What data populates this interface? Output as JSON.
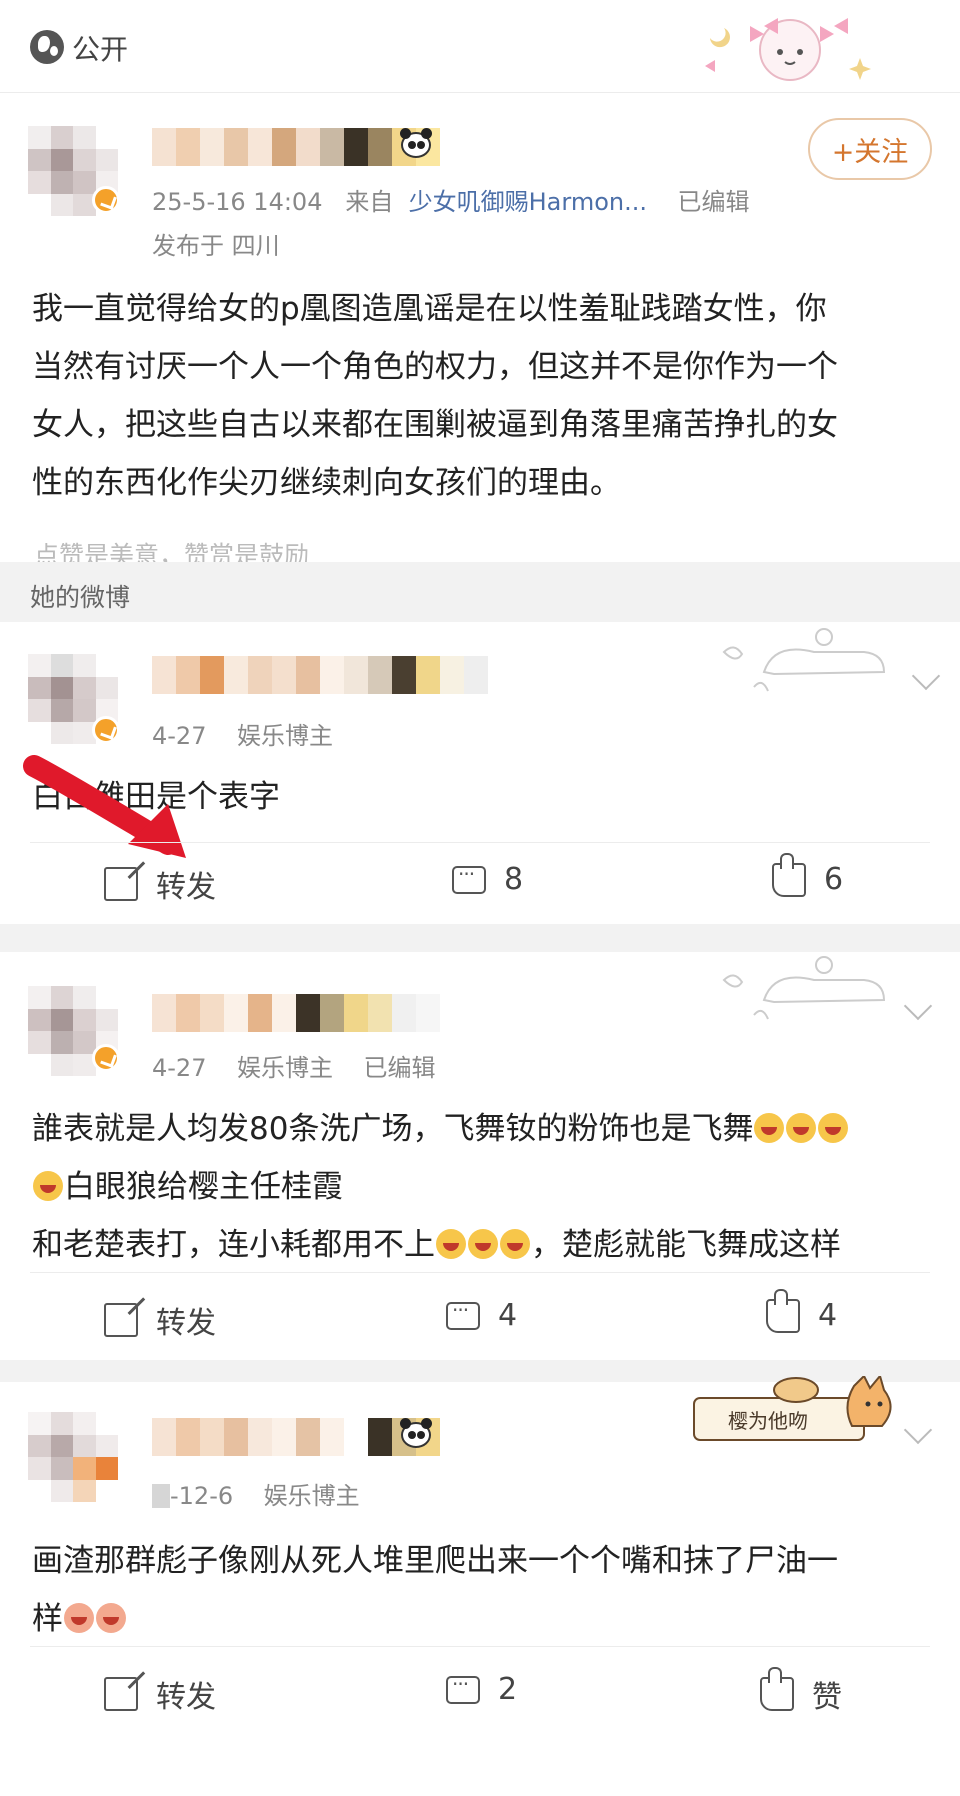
{
  "topbar": {
    "visibility_label": "公开"
  },
  "main_post": {
    "time": "25-5-16 14:04",
    "source_prefix": "来自",
    "source_device": "少女叽御赐Harmon...",
    "edited": "已编辑",
    "location": "发布于 四川",
    "follow_label": "+关注",
    "content": [
      "我一直觉得给女的p凰图造凰谣是在以性羞耻践踏女性，你",
      "当然有讨厌一个人一个角色的权力，但这并不是你作为一个",
      "女人，把这些自古以来都在围剿被逼到角落里痛苦挣扎的女",
      "性的东西化作尖刃继续刺向女孩们的理由。"
    ],
    "hint": "点赞是美意，赞赏是鼓励"
  },
  "section": {
    "title": "她的微博"
  },
  "posts": [
    {
      "time": "4-27",
      "tag": "娱乐博主",
      "edited": "",
      "content_lines": [
        "白白雏田是个表字"
      ],
      "repost_label": "转发",
      "comment_count": "8",
      "like_count": "6"
    },
    {
      "time": "4-27",
      "tag": "娱乐博主",
      "edited": "已编辑",
      "content_line1": "誰表就是人均发80条洗广场，飞舞钕的粉饰也是飞舞",
      "content_line2": "白眼狼给樱主任桂霞",
      "content_line3a": "和老楚表打，连小耗都用不上",
      "content_line3b": "，楚彪就能飞舞成这样",
      "repost_label": "转发",
      "comment_count": "4",
      "like_count": "4"
    },
    {
      "time": "-12-6",
      "tag": "娱乐博主",
      "content_line1": "画渣那群彪子像刚从死人堆里爬出来一个个嘴和抹了尸油一",
      "content_line2": "样",
      "repost_label": "转发",
      "comment_count": "2",
      "like_label": "赞",
      "sticker_text": "樱为他吻"
    }
  ],
  "colors": {
    "link": "#4c6fa8",
    "follow_accent": "#d4762e",
    "band": "#f2f2f2",
    "arrow": "#e0192b"
  },
  "icons": [
    "globe-icon",
    "repost-icon",
    "comment-icon",
    "like-icon",
    "chevron-down-icon",
    "panda-emoji-icon"
  ]
}
